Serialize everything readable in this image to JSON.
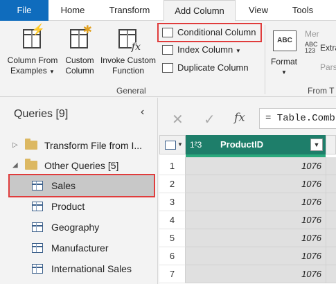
{
  "tabs": {
    "file": "File",
    "home": "Home",
    "transform": "Transform",
    "add_column": "Add Column",
    "view": "View",
    "tools": "Tools"
  },
  "ribbon": {
    "column_from_examples": [
      "Column From",
      "Examples"
    ],
    "custom_column": [
      "Custom",
      "Column"
    ],
    "invoke_custom_function": [
      "Invoke Custom",
      "Function"
    ],
    "conditional_column": "Conditional Column",
    "index_column": "Index Column",
    "duplicate_column": "Duplicate Column",
    "general_group": "General",
    "format": "Format",
    "format_icon_text": "ABC",
    "merge": "Mer",
    "extract": "Extra",
    "parse": "Pars",
    "from_group": "From T",
    "abc123": "ABC 123"
  },
  "queries": {
    "title": "Queries [9]",
    "items": [
      {
        "label": "Transform File from I..."
      },
      {
        "label": "Other Queries [5]"
      },
      {
        "label": "Sales"
      },
      {
        "label": "Product"
      },
      {
        "label": "Geography"
      },
      {
        "label": "Manufacturer"
      },
      {
        "label": "International Sales"
      }
    ]
  },
  "formula_bar": {
    "cancel": "✕",
    "confirm": "✓",
    "fx": "fx",
    "text": "= Table.Comb"
  },
  "grid": {
    "column_type": "1²3",
    "column_name": "ProductID",
    "rows": [
      {
        "n": "1",
        "v": "1076"
      },
      {
        "n": "2",
        "v": "1076"
      },
      {
        "n": "3",
        "v": "1076"
      },
      {
        "n": "4",
        "v": "1076"
      },
      {
        "n": "5",
        "v": "1076"
      },
      {
        "n": "6",
        "v": "1076"
      },
      {
        "n": "7",
        "v": "1076"
      }
    ]
  }
}
